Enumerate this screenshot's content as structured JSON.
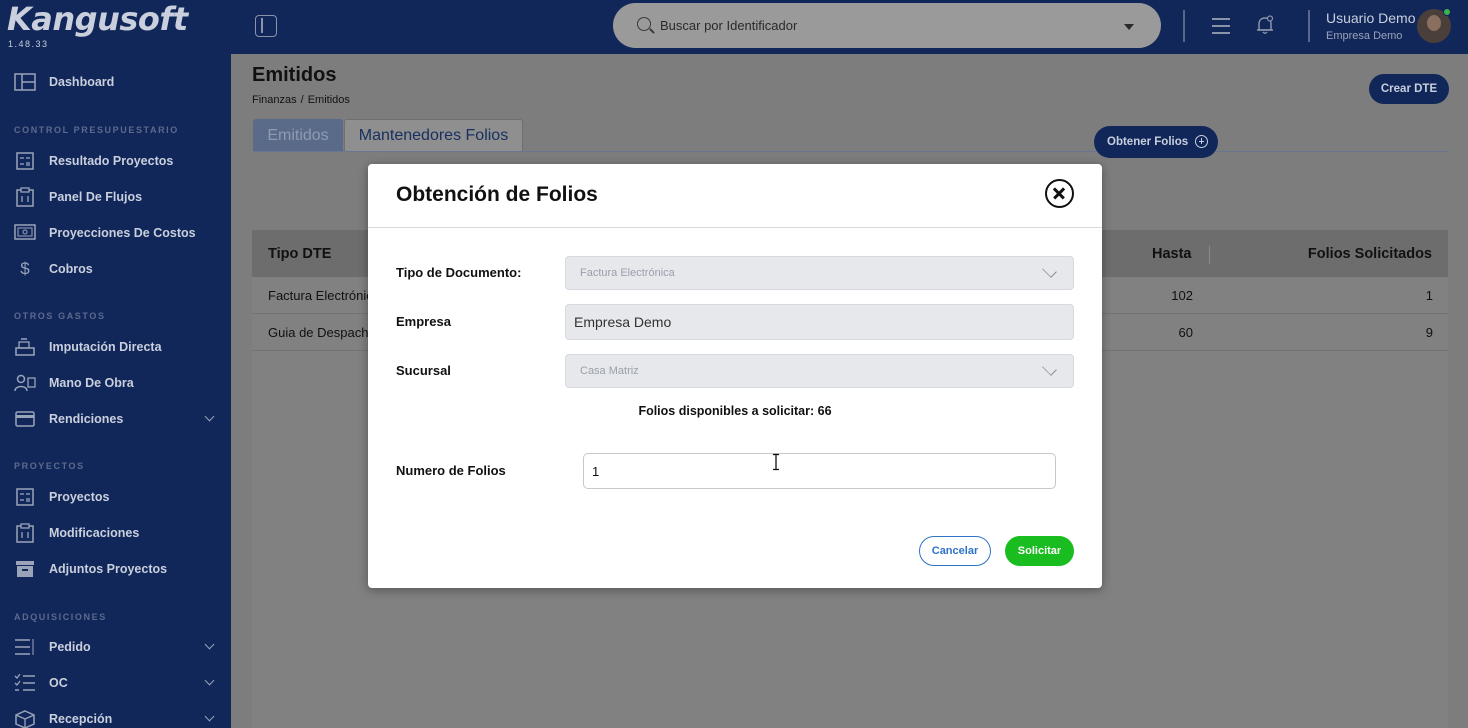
{
  "app": {
    "logo": "Kangusoft",
    "version": "1.48.33"
  },
  "sidebar": {
    "dashboard": "Dashboard",
    "sections": {
      "control": "CONTROL PRESUPUESTARIO",
      "otros": "OTROS GASTOS",
      "proyectos": "PROYECTOS",
      "adquisiciones": "ADQUISICIONES"
    },
    "items": {
      "resultado": "Resultado Proyectos",
      "panel": "Panel De Flujos",
      "proyecciones": "Proyecciones De Costos",
      "cobros": "Cobros",
      "imputacion": "Imputación Directa",
      "mano": "Mano De Obra",
      "rendiciones": "Rendiciones",
      "proyectos": "Proyectos",
      "modificaciones": "Modificaciones",
      "adjuntos": "Adjuntos Proyectos",
      "pedido": "Pedido",
      "oc": "OC",
      "recepcion": "Recepción"
    }
  },
  "topbar": {
    "search_placeholder": "Buscar por Identificador",
    "user_name": "Usuario Demo",
    "user_company": "Empresa Demo"
  },
  "page": {
    "title": "Emitidos",
    "breadcrumb": [
      "Finanzas",
      "Emitidos"
    ],
    "crear_label": "Crear DTE",
    "tabs": [
      "Emitidos",
      "Mantenedores Folios"
    ],
    "obtener_label": "Obtener Folios"
  },
  "table": {
    "headers": {
      "tipo": "Tipo DTE",
      "hasta": "Hasta",
      "solicitados": "Folios Solicitados"
    },
    "rows": [
      {
        "tipo": "Factura Electrónica",
        "hasta": "102",
        "solicitados": "1"
      },
      {
        "tipo": "Guia de Despacho",
        "hasta": "60",
        "solicitados": "9"
      }
    ]
  },
  "modal": {
    "title": "Obtención de Folios",
    "tipo_label": "Tipo de Documento:",
    "tipo_value": "Factura Electrónica",
    "empresa_label": "Empresa",
    "empresa_value": "Empresa Demo",
    "sucursal_label": "Sucursal",
    "sucursal_value": "Casa Matriz",
    "available_text": "Folios disponibles a solicitar: 66",
    "numero_label": "Numero de Folios",
    "numero_value": "1",
    "cancel_label": "Cancelar",
    "submit_label": "Solicitar"
  },
  "colors": {
    "sidebar_bg": "#11275a",
    "accent": "#2f73c8",
    "submit": "#19bd1f"
  }
}
